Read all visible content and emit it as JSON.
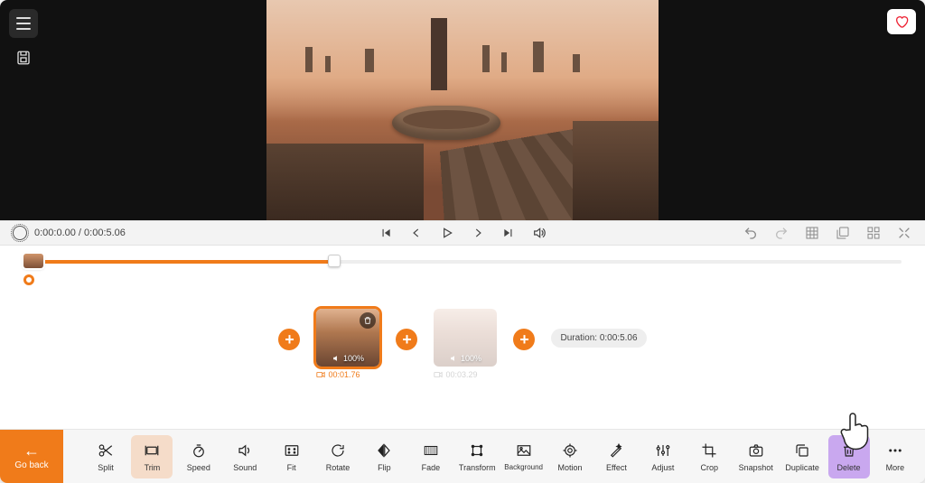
{
  "preview": {},
  "control_bar": {
    "time_display": "0:00:0.00 / 0:00:5.06"
  },
  "timeline": {
    "progress_pct": 34
  },
  "clips": {
    "add_symbol": "+",
    "items": [
      {
        "volume_label": "100%",
        "time_label": "00:01.76",
        "selected": true
      },
      {
        "volume_label": "100%",
        "time_label": "00:03.29",
        "selected": false
      }
    ],
    "duration_label": "Duration: 0:00:5.06"
  },
  "toolbar": {
    "go_back_label": "Go back",
    "tools": {
      "split": "Split",
      "trim": "Trim",
      "speed": "Speed",
      "sound": "Sound",
      "fit": "Fit",
      "rotate": "Rotate",
      "flip": "Flip",
      "fade": "Fade",
      "transform": "Transform",
      "background": "Background",
      "motion": "Motion",
      "effect": "Effect",
      "adjust": "Adjust",
      "crop": "Crop",
      "snapshot": "Snapshot",
      "duplicate": "Duplicate",
      "delete": "Delete",
      "more": "More"
    }
  }
}
